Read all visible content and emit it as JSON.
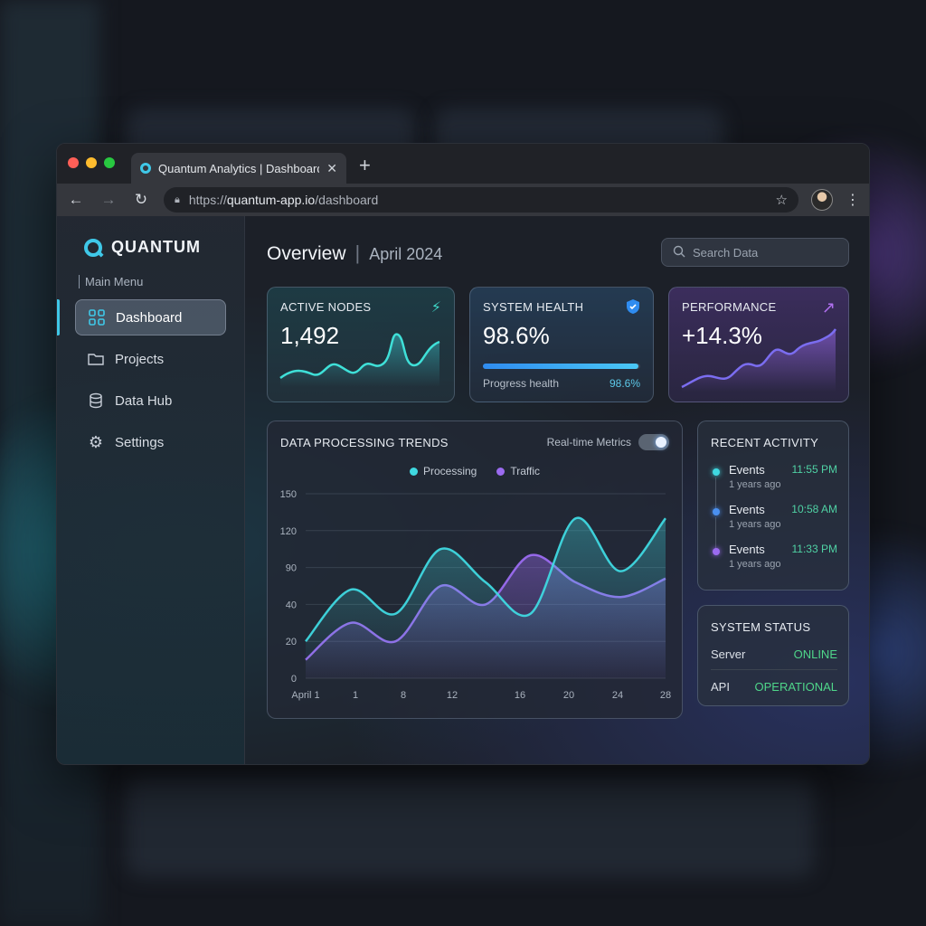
{
  "browser": {
    "tab_title": "Quantum Analytics | Dashboard",
    "url_prefix": "https://",
    "url_host": "quantum-app.io",
    "url_path": "/dashboard"
  },
  "sidebar": {
    "brand": "QUANTUM",
    "menu_label": "Main Menu",
    "items": [
      {
        "label": "Dashboard",
        "icon": "grid-icon",
        "active": true
      },
      {
        "label": "Projects",
        "icon": "folder-icon",
        "active": false
      },
      {
        "label": "Data Hub",
        "icon": "database-icon",
        "active": false
      },
      {
        "label": "Settings",
        "icon": "gear-icon",
        "active": false
      }
    ]
  },
  "header": {
    "title": "Overview",
    "subtitle": "April 2024",
    "search_placeholder": "Search Data"
  },
  "stats": {
    "active_nodes": {
      "label": "ACTIVE NODES",
      "value": "1,492",
      "icon": "lightning-icon"
    },
    "system_health": {
      "label": "SYSTEM HEALTH",
      "value": "98.6%",
      "icon": "shield-check-icon",
      "progress_label": "Progress health",
      "progress_pct": "98.6%",
      "progress_fraction": 0.986
    },
    "performance": {
      "label": "PERFORMANCE",
      "value": "+14.3%",
      "icon": "trend-up-icon"
    }
  },
  "chart_data": {
    "type": "line",
    "title": "DATA PROCESSING TRENDS",
    "toggle_label": "Real-time Metrics",
    "toggle_on": true,
    "x_ticks": [
      "April 1",
      "1",
      "8",
      "12",
      "16",
      "20",
      "24",
      "28"
    ],
    "y_ticks": [
      0,
      20,
      40,
      90,
      120,
      150
    ],
    "series": [
      {
        "name": "Processing",
        "color": "#3fd8e0",
        "values": [
          20,
          60,
          35,
          105,
          70,
          35,
          130,
          85,
          130
        ]
      },
      {
        "name": "Traffic",
        "color": "#9b6bf0",
        "values": [
          10,
          30,
          20,
          65,
          40,
          100,
          70,
          50,
          75
        ]
      }
    ],
    "legend": "top-center",
    "grid": true
  },
  "activity": {
    "title": "RECENT ACTIVITY",
    "items": [
      {
        "name": "Events",
        "time": "11:55 PM",
        "ago": "1 years ago",
        "color": "#3fd8e0"
      },
      {
        "name": "Events",
        "time": "10:58 AM",
        "ago": "1 years ago",
        "color": "#4a90f0"
      },
      {
        "name": "Events",
        "time": "11:33 PM",
        "ago": "1 years ago",
        "color": "#9b6bf0"
      }
    ]
  },
  "status": {
    "title": "SYSTEM STATUS",
    "rows": [
      {
        "label": "Server",
        "value": "ONLINE"
      },
      {
        "label": "API",
        "value": "OPERATIONAL"
      }
    ]
  }
}
